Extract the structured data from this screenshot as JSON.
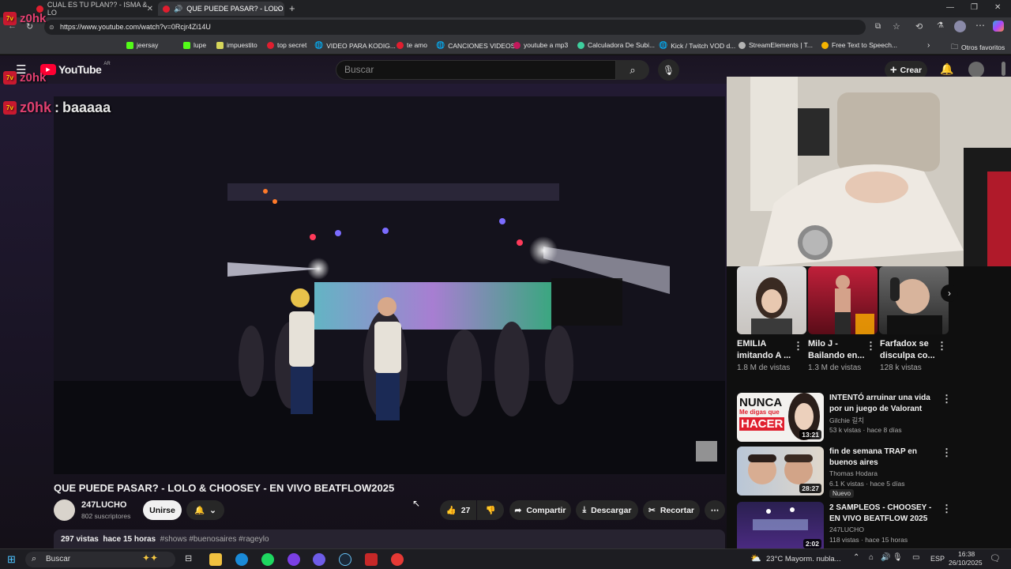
{
  "browser": {
    "tabs": [
      {
        "label": "CUAL ES TU PLAN?? - ISMA & LO"
      },
      {
        "label": "QUE PUEDE PASAR? - LOLO"
      }
    ],
    "url": "https://www.youtube.com/watch?v=0Rcjr4Zi14U",
    "bookmarks": [
      "jeersay",
      "lupe",
      "impuestito",
      "top secret",
      "VIDEO PARA KODIG...",
      "te amo",
      "CANCIONES VIDEOS",
      "youtube a mp3",
      "Calculadora De Subi...",
      "Kick / Twitch VOD d...",
      "StreamElements | T...",
      "Free Text to Speech..."
    ],
    "other_favorites": "Otros favoritos"
  },
  "youtube": {
    "logo": "YouTube",
    "region": "AR",
    "search_placeholder": "Buscar",
    "create_label": "Crear"
  },
  "chat_overlay": [
    {
      "user": "z0hk",
      "message": ""
    },
    {
      "user": "z0hk",
      "message": ""
    },
    {
      "user": "z0hk",
      "message": "baaaaa"
    }
  ],
  "video": {
    "title": "QUE PUEDE PASAR? - LOLO & CHOOSEY - EN VIVO BEATFLOW2025",
    "channel": "247LUCHO",
    "subscribers": "802 suscriptores",
    "join_label": "Unirse",
    "likes": "27",
    "share_label": "Compartir",
    "download_label": "Descargar",
    "clip_label": "Recortar",
    "views": "297 vistas",
    "time_ago": "hace 15 horas",
    "hashtags": "#shows #buenosaires #rageylo"
  },
  "shorts": [
    {
      "title": "EMILIA imitando A ...",
      "views": "1.8 M de vistas"
    },
    {
      "title": "Milo J - Bailando en...",
      "views": "1.3 M de vistas"
    },
    {
      "title": "Farfadox se disculpa co...",
      "views": "128 k vistas"
    }
  ],
  "recommendations": [
    {
      "title": "INTENTÓ arruinar una vida por un juego de Valorant",
      "channel": "Gilchie 길치",
      "meta": "53 k vistas · hace 8 días",
      "duration": "13:21",
      "thumb_text_1": "NUNCA",
      "thumb_text_2": "Me digas que",
      "thumb_text_3": "HACER",
      "badge": ""
    },
    {
      "title": "fin de semana TRAP en buenos aires",
      "channel": "Thomas Hodara",
      "meta": "6.1 K vistas · hace 5 días",
      "duration": "28:27",
      "badge": "Nuevo"
    },
    {
      "title": "2 SAMPLEOS - CHOOSEY - EN VIVO BEATFLOW 2025",
      "channel": "247LUCHO",
      "meta": "118 vistas · hace 15 horas",
      "duration": "2:02",
      "badge": ""
    }
  ],
  "taskbar": {
    "search_placeholder": "Buscar",
    "weather": "23°C  Mayorm. nubla...",
    "lang": "ESP",
    "time": "16:38",
    "date": "26/10/2025"
  },
  "colors": {
    "accent": "#ff0033",
    "background": "#0f0f0f"
  }
}
